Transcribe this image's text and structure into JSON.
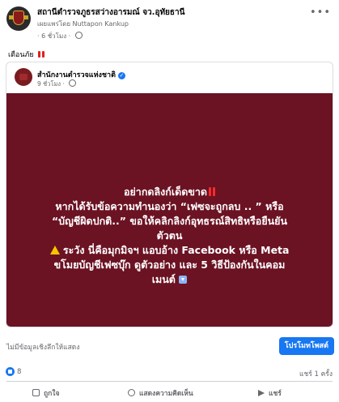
{
  "post": {
    "page_name": "สถานีตำรวจภูธรสว่างอารมณ์ จว.อุทัยธานี",
    "published_by": "เผยแพร่โดย Nuttapon Kankup",
    "time": "· 6 ชั่วโมง ·",
    "caption": "เตือนภัย"
  },
  "shared": {
    "page_name": "สำนักงานตำรวจแห่งชาติ",
    "time": "9 ชั่วโมง ·",
    "banner_lines": [
      "อย่ากดลิงก์เด็ดขาด",
      "หากได้รับข้อความทำนองว่า “เฟซจะถูกลบ .. ” หรือ",
      "“บัญชีผิดปกติ..” ขอให้คลิกลิงก์อุทธรณ์สิทธิหรือยืนยัน",
      "ตัวตน",
      "ระวัง นี่คือมุกมิจฯ แอบอ้าง Facebook หรือ Meta",
      "ขโมยบัญชีเฟซบุ๊ก ดูตัวอย่าง และ 5 วิธีป้องกันในคอม",
      "เมนต์"
    ],
    "banner_color": "#6b1223"
  },
  "ad": {
    "no_data": "ไม่มีข้อมูลเชิงลึกให้แสดง",
    "boost_label": "โปรโมทโพสต์"
  },
  "stats": {
    "likes": "8",
    "shares": "แชร์ 1 ครั้ง"
  },
  "actions": {
    "like": "ถูกใจ",
    "comment": "แสดงความคิดเห็น",
    "share": "แชร์"
  },
  "icons": [
    "police-badge-icon",
    "globe-icon",
    "more-icon",
    "warning-icon",
    "verified-icon",
    "down-arrow-icon",
    "like-icon",
    "comment-icon",
    "share-icon"
  ],
  "colors": {
    "accent": "#1877f2",
    "banner": "#6b1223"
  }
}
